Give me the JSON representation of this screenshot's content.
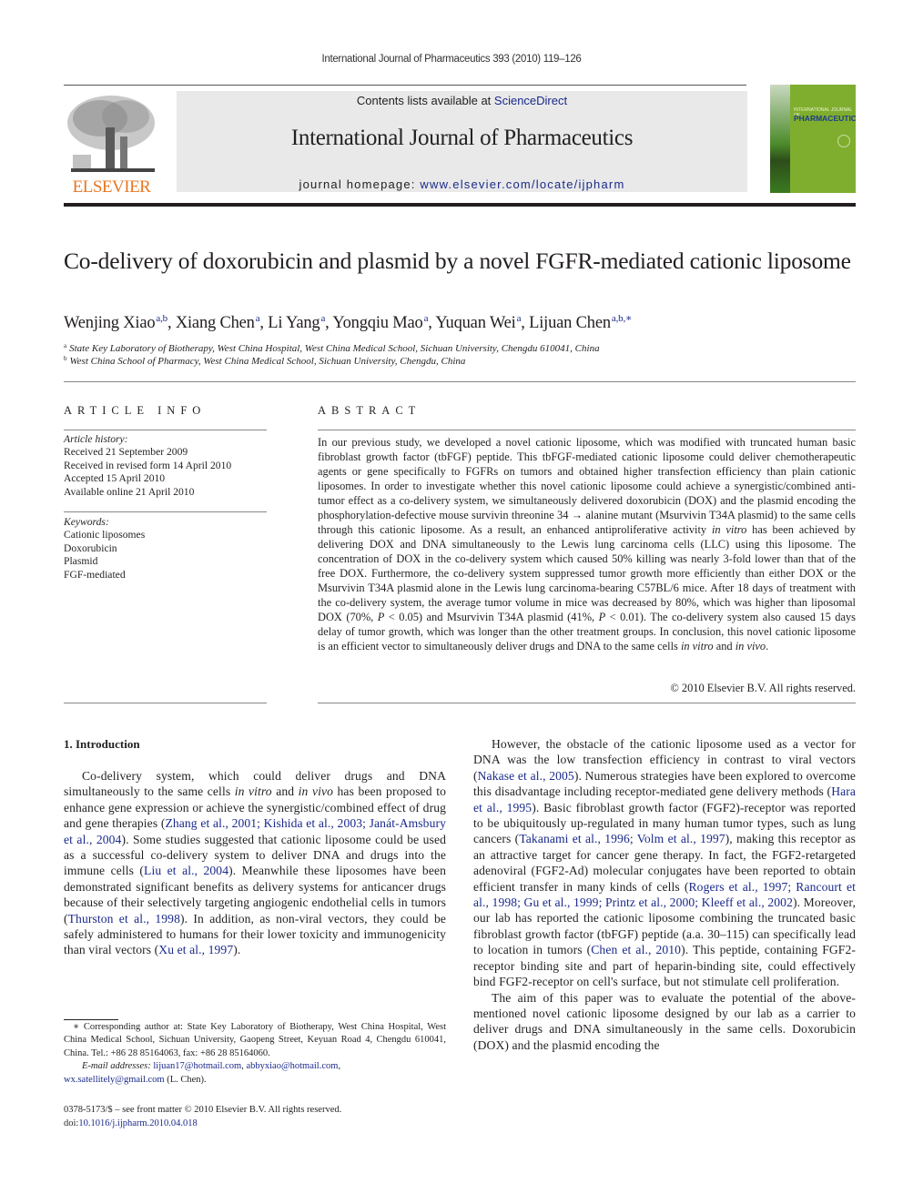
{
  "header": {
    "running_head": "International Journal of Pharmaceutics 393 (2010) 119–126",
    "contents_prefix": "Contents lists available at ",
    "contents_link": "ScienceDirect",
    "journal_title": "International Journal of Pharmaceutics",
    "homepage_prefix": "journal homepage: ",
    "homepage_link": "www.elsevier.com/locate/ijpharm",
    "publisher_logo_text": "ELSEVIER",
    "cover": {
      "line1": "INTERNATIONAL JOURNAL OF",
      "line2": "PHARMACEUTICS"
    },
    "colors": {
      "elsevier_orange": "#e87722",
      "link_blue": "#1a2a8a",
      "cover_green": "#7fae2e",
      "banner_gray": "#e9e9e9"
    }
  },
  "article": {
    "title": "Co-delivery of doxorubicin and plasmid by a novel FGFR-mediated cationic liposome",
    "authors": [
      {
        "name": "Wenjing Xiao",
        "sup": "a,b"
      },
      {
        "name": "Xiang Chen",
        "sup": "a"
      },
      {
        "name": "Li Yang",
        "sup": "a"
      },
      {
        "name": "Yongqiu Mao",
        "sup": "a"
      },
      {
        "name": "Yuquan Wei",
        "sup": "a"
      },
      {
        "name": "Lijuan Chen",
        "sup": "a,b,∗"
      }
    ],
    "affiliations": [
      {
        "mark": "a",
        "text": "State Key Laboratory of Biotherapy, West China Hospital, West China Medical School, Sichuan University, Chengdu 610041, China"
      },
      {
        "mark": "b",
        "text": "West China School of Pharmacy, West China Medical School, Sichuan University, Chengdu, China"
      }
    ]
  },
  "article_info": {
    "heading": "ARTICLE INFO",
    "history_label": "Article history:",
    "history": [
      "Received 21 September 2009",
      "Received in revised form 14 April 2010",
      "Accepted 15 April 2010",
      "Available online 21 April 2010"
    ],
    "keywords_label": "Keywords:",
    "keywords": [
      "Cationic liposomes",
      "Doxorubicin",
      "Plasmid",
      "FGF-mediated"
    ]
  },
  "abstract": {
    "heading": "ABSTRACT",
    "parts": [
      "In our previous study, we developed a novel cationic liposome, which was modified with truncated human basic fibroblast growth factor (tbFGF) peptide. This tbFGF-mediated cationic liposome could deliver chemotherapeutic agents or gene specifically to FGFRs on tumors and obtained higher transfection efficiency than plain cationic liposomes. In order to investigate whether this novel cationic liposome could achieve a synergistic/combined anti-tumor effect as a co-delivery system, we simultaneously delivered doxorubicin (DOX) and the plasmid encoding the phosphorylation-defective mouse survivin threonine 34 → alanine mutant (Msurvivin T34A plasmid) to the same cells through this cationic liposome. As a result, an enhanced antiproliferative activity ",
      "in vitro",
      " has been achieved by delivering DOX and DNA simultaneously to the Lewis lung carcinoma cells (LLC) using this liposome. The concentration of DOX in the co-delivery system which caused 50% killing was nearly 3-fold lower than that of the free DOX. Furthermore, the co-delivery system suppressed tumor growth more efficiently than either DOX or the Msurvivin T34A plasmid alone in the Lewis lung carcinoma-bearing C57BL/6 mice. After 18 days of treatment with the co-delivery system, the average tumor volume in mice was decreased by 80%, which was higher than liposomal DOX (70%, ",
      "P",
      " < 0.05) and Msurvivin T34A plasmid (41%, ",
      "P",
      " < 0.01). The co-delivery system also caused 15 days delay of tumor growth, which was longer than the other treatment groups. In conclusion, this novel cationic liposome is an efficient vector to simultaneously deliver drugs and DNA to the same cells ",
      "in vitro",
      " and ",
      "in vivo",
      "."
    ],
    "copyright": "© 2010 Elsevier B.V. All rights reserved."
  },
  "introduction": {
    "heading": "1.  Introduction",
    "col1_p1": [
      "Co-delivery system, which could deliver drugs and DNA simultaneously to the same cells ",
      "in vitro",
      " and ",
      "in vivo",
      " has been proposed to enhance gene expression or achieve the synergistic/combined effect of drug and gene therapies (",
      "Zhang et al., 2001; Kishida et al., 2003; Janát-Amsbury et al., 2004",
      "). Some studies suggested that cationic liposome could be used as a successful co-delivery system to deliver DNA and drugs into the immune cells (",
      "Liu et al., 2004",
      "). Meanwhile these liposomes have been demonstrated significant benefits as delivery systems for anticancer drugs because of their selectively targeting angiogenic endothelial cells in tumors (",
      "Thurston et al., 1998",
      "). In addition, as non-viral vectors, they could be safely administered to humans for their lower toxicity and immunogenicity than viral vectors (",
      "Xu et al., 1997",
      ")."
    ],
    "col2_p1": [
      "However, the obstacle of the cationic liposome used as a vector for DNA was the low transfection efficiency in contrast to viral vectors (",
      "Nakase et al., 2005",
      "). Numerous strategies have been explored to overcome this disadvantage including receptor-mediated gene delivery methods (",
      "Hara et al., 1995",
      "). Basic fibroblast growth factor (FGF2)-receptor was reported to be ubiquitously up-regulated in many human tumor types, such as lung cancers (",
      "Takanami et al., 1996; Volm et al., 1997",
      "), making this receptor as an attractive target for cancer gene therapy. In fact, the FGF2-retargeted adenoviral (FGF2-Ad) molecular conjugates have been reported to obtain efficient transfer in many kinds of cells (",
      "Rogers et al., 1997; Rancourt et al., 1998; Gu et al., 1999; Printz et al., 2000; Kleeff et al., 2002",
      "). Moreover, our lab has reported the cationic liposome combining the truncated basic fibroblast growth factor (tbFGF) peptide (a.a. 30–115) can specifically lead to location in tumors (",
      "Chen et al., 2010",
      "). This peptide, containing FGF2-receptor binding site and part of heparin-binding site, could effectively bind FGF2-receptor on cell's surface, but not stimulate cell proliferation."
    ],
    "col2_p2": "The aim of this paper was to evaluate the potential of the above-mentioned novel cationic liposome designed by our lab as a carrier to deliver drugs and DNA simultaneously in the same cells. Doxorubicin (DOX) and the plasmid encoding the"
  },
  "footnotes": {
    "corresponding": "∗ Corresponding author at: State Key Laboratory of Biotherapy, West China Hospital, West China Medical School, Sichuan University, Gaopeng Street, Keyuan Road 4, Chengdu 610041, China. Tel.: +86 28 85164063, fax: +86 28 85164060.",
    "email_label": "E-mail addresses:",
    "emails": [
      "lijuan17@hotmail.com",
      "abbyxiao@hotmail.com",
      "wx.satellitely@gmail.com"
    ],
    "email_owner": " (L. Chen).",
    "issn": "0378-5173/$ – see front matter © 2010 Elsevier B.V. All rights reserved.",
    "doi_prefix": "doi:",
    "doi": "10.1016/j.ijpharm.2010.04.018"
  }
}
